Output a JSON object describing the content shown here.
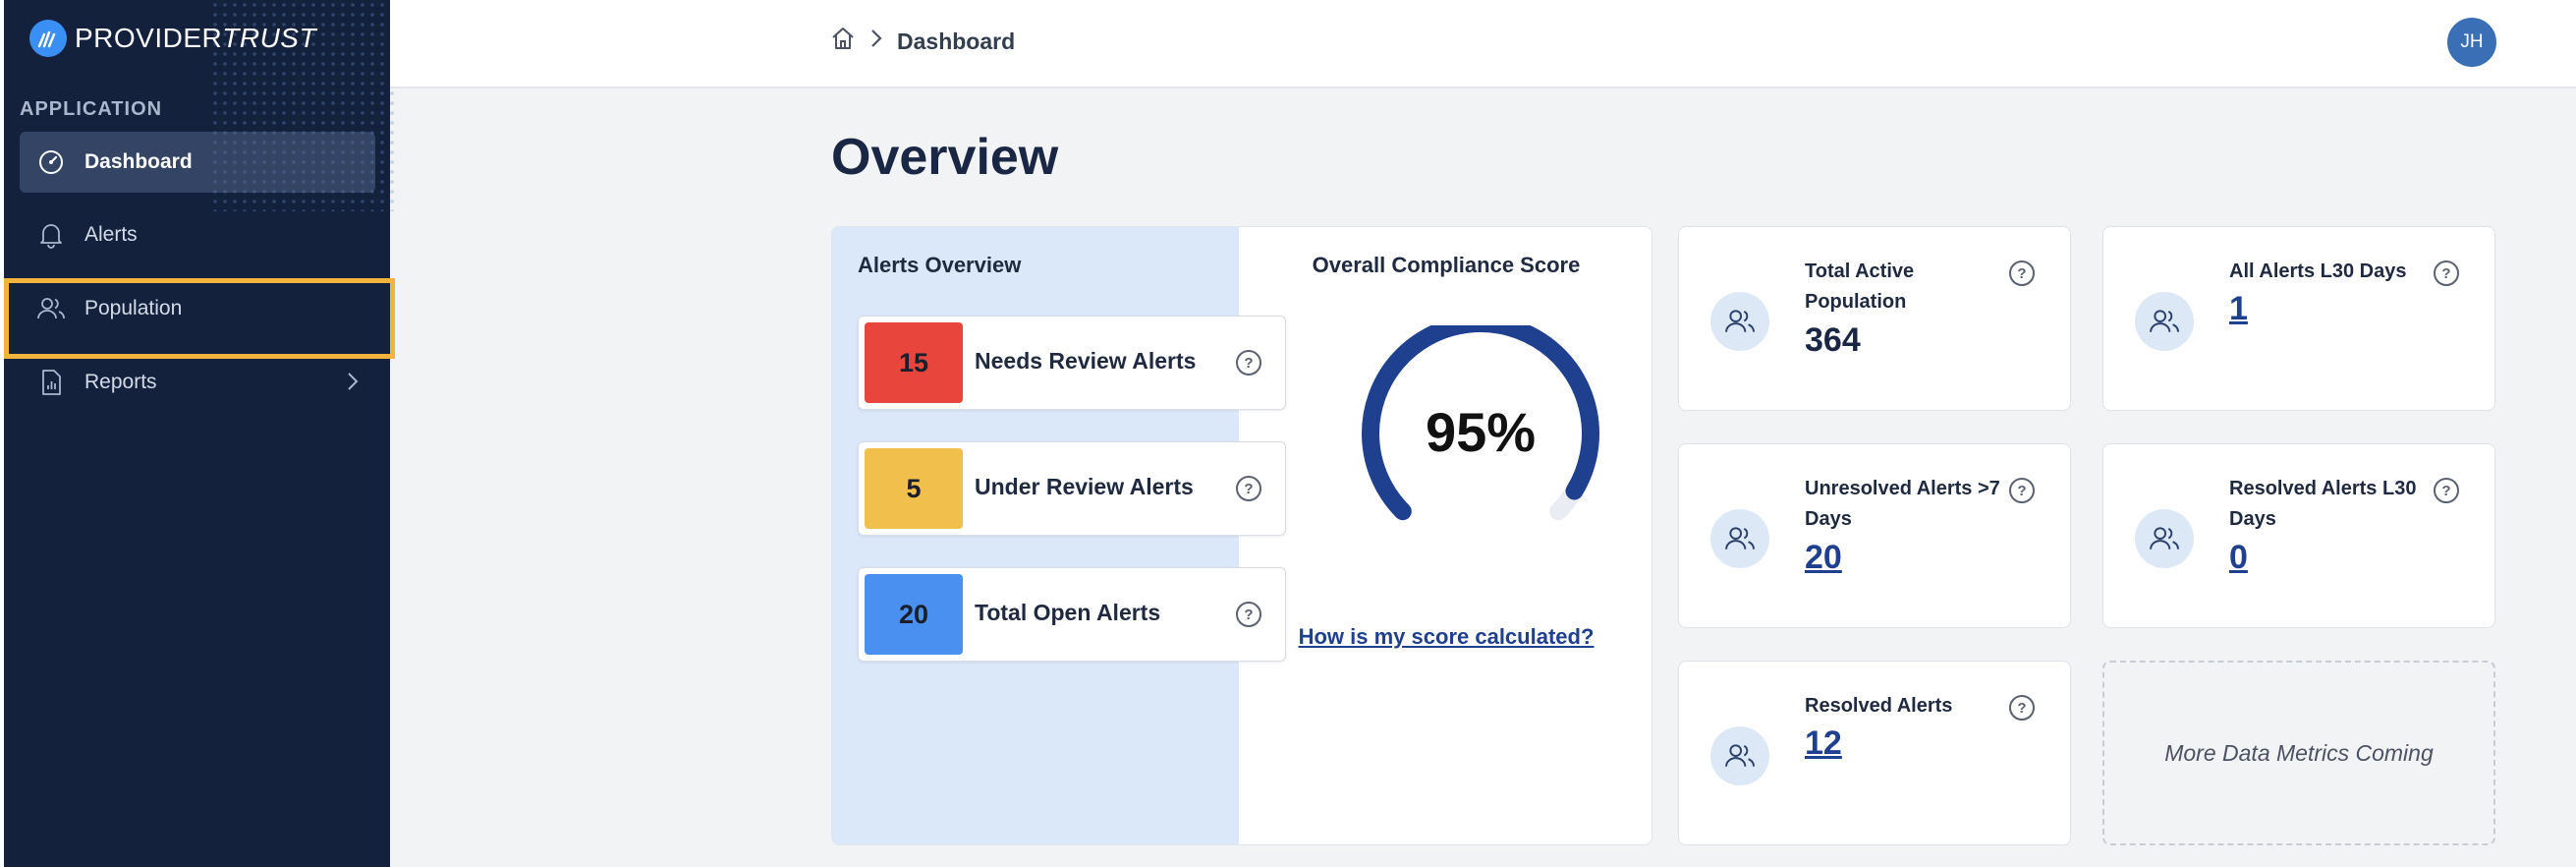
{
  "brand": {
    "name_bold": "PROVIDER",
    "name_light": "TRUST"
  },
  "sidebar": {
    "section": "APPLICATION",
    "items": [
      {
        "label": "Dashboard",
        "icon": "gauge-icon",
        "active": true
      },
      {
        "label": "Alerts",
        "icon": "bell-icon"
      },
      {
        "label": "Population",
        "icon": "users-icon"
      },
      {
        "label": "Reports",
        "icon": "report-icon"
      }
    ]
  },
  "header": {
    "breadcrumb": "Dashboard",
    "avatar_initials": "JH"
  },
  "page": {
    "title": "Overview"
  },
  "alerts_overview": {
    "title": "Alerts Overview",
    "rows": [
      {
        "count": "15",
        "label": "Needs Review Alerts",
        "color": "#e8453c"
      },
      {
        "count": "5",
        "label": "Under Review Alerts",
        "color": "#f0bf4c"
      },
      {
        "count": "20",
        "label": "Total Open Alerts",
        "color": "#4a90f0"
      }
    ]
  },
  "compliance": {
    "title": "Overall Compliance Score",
    "score": "95%",
    "score_value": 0.95,
    "link": "How is my score calculated?"
  },
  "metrics": {
    "total_active": {
      "label": "Total Active Population",
      "value": "364"
    },
    "all_alerts": {
      "label": "All Alerts L30 Days",
      "value": "1"
    },
    "unresolved": {
      "label": "Unresolved Alerts >7 Days",
      "value": "20"
    },
    "resolved_l30": {
      "label": "Resolved Alerts L30 Days",
      "value": "0"
    },
    "resolved": {
      "label": "Resolved Alerts",
      "value": "12"
    },
    "coming": "More Data Metrics Coming"
  },
  "colors": {
    "sidebar": "#14213d",
    "accent": "#1f3f8f",
    "gauge": "#1f3f8f",
    "highlight": "#f2b43d"
  }
}
